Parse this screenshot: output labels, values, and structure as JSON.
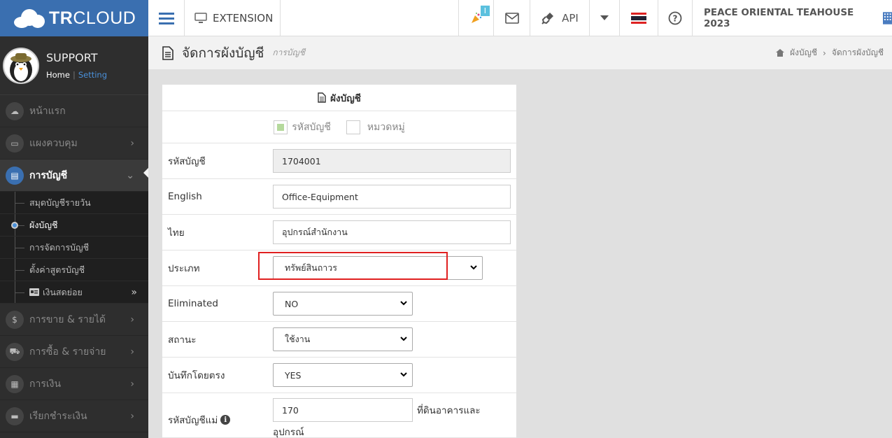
{
  "topbar": {
    "logo_text_bold": "TR",
    "logo_text": "CLOUD",
    "extension_label": "EXTENSION",
    "notification_count": "I",
    "api_label": "API",
    "company_name": "PEACE ORIENTAL TEAHOUSE 2023"
  },
  "sidebar": {
    "user_name": "SUPPORT",
    "home_link": "Home",
    "separator": "|",
    "setting_link": "Setting",
    "items": [
      {
        "label": "หน้าแรก",
        "icon": "cloud-icon"
      },
      {
        "label": "แผงควบคุม",
        "icon": "monitor-icon"
      },
      {
        "label": "การบัญชี",
        "icon": "book-icon"
      },
      {
        "label": "การขาย & รายได้",
        "icon": "dollar-icon"
      },
      {
        "label": "การซื้อ & รายจ่าย",
        "icon": "cart-icon"
      },
      {
        "label": "การเงิน",
        "icon": "calendar-icon"
      },
      {
        "label": "เรียกชำระเงิน",
        "icon": "card-icon"
      }
    ],
    "subitems": [
      {
        "label": "สมุดบัญชีรายวัน"
      },
      {
        "label": "ผังบัญชี"
      },
      {
        "label": "การจัดการบัญชี"
      },
      {
        "label": "ตั้งค่าสูตรบัญชี"
      },
      {
        "label": "เงินสดย่อย"
      }
    ]
  },
  "header": {
    "title": "จัดการผังบัญชี",
    "subtitle": "การบัญชี",
    "breadcrumb": [
      "ผังบัญชี",
      "จัดการผังบัญชี"
    ]
  },
  "panel": {
    "title": "ผังบัญชี",
    "check_account_code": "รหัสบัญชี",
    "check_category": "หมวดหมู่",
    "fields": {
      "code_label": "รหัสบัญชี",
      "code_value": "1704001",
      "english_label": "English",
      "english_value": "Office-Equipment",
      "thai_label": "ไทย",
      "thai_value": "อุปกรณ์สำนักงาน",
      "type_label": "ประเภท",
      "type_value": "ทรัพย์สินถาวร",
      "eliminated_label": "Eliminated",
      "eliminated_value": "NO",
      "status_label": "สถานะ",
      "status_value": "ใช้งาน",
      "direct_label": "บันทึกโดยตรง",
      "direct_value": "YES",
      "parent_label": "รหัสบัญชีแม่",
      "parent_value": "170",
      "parent_desc_line1": "ที่ดินอาคารและ",
      "parent_desc_line2": "อุปกรณ์"
    }
  },
  "colors": {
    "brand": "#3a6fb0",
    "highlight": "#e02020",
    "sidebar_bg": "#2e2e2e"
  }
}
